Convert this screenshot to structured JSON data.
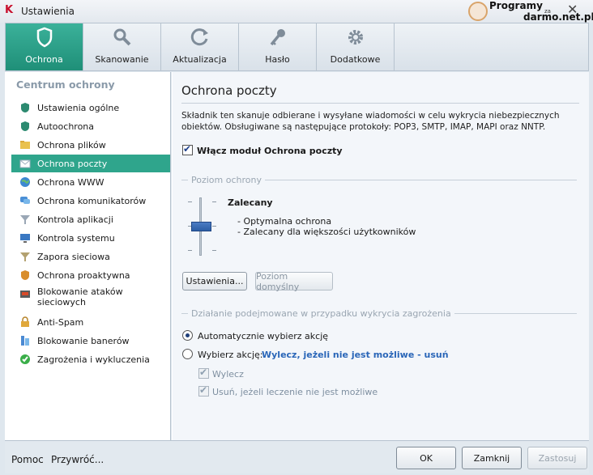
{
  "window": {
    "title": "Ustawienia"
  },
  "watermark": {
    "line1": "Programy",
    "line2": "za",
    "line3": "darmo.net.pl"
  },
  "tabs": [
    {
      "label": "Ochrona",
      "icon": "shield-icon",
      "active": true
    },
    {
      "label": "Skanowanie",
      "icon": "magnifier-icon"
    },
    {
      "label": "Aktualizacja",
      "icon": "refresh-icon"
    },
    {
      "label": "Hasło",
      "icon": "key-icon"
    },
    {
      "label": "Dodatkowe",
      "icon": "gear-icon"
    }
  ],
  "sidebar": {
    "heading": "Centrum ochrony",
    "items": [
      {
        "label": "Ustawienia ogólne",
        "icon": "shield-green-icon"
      },
      {
        "label": "Autoochrona",
        "icon": "shield-green-icon"
      },
      {
        "label": "Ochrona plików",
        "icon": "folder-icon"
      },
      {
        "label": "Ochrona poczty",
        "icon": "envelope-icon",
        "active": true
      },
      {
        "label": "Ochrona WWW",
        "icon": "globe-icon"
      },
      {
        "label": "Ochrona komunikatorów",
        "icon": "chat-icon"
      },
      {
        "label": "Kontrola aplikacji",
        "icon": "funnel-icon"
      },
      {
        "label": "Kontrola systemu",
        "icon": "monitor-icon"
      },
      {
        "label": "Zapora sieciowa",
        "icon": "funnel-icon"
      },
      {
        "label": "Ochrona proaktywna",
        "icon": "shield-orange-icon"
      },
      {
        "label": "Blokowanie ataków sieciowych",
        "icon": "network-icon"
      },
      {
        "label": "Anti-Spam",
        "icon": "lock-icon"
      },
      {
        "label": "Blokowanie banerów",
        "icon": "banner-icon"
      },
      {
        "label": "Zagrożenia i wykluczenia",
        "icon": "check-circle-icon"
      }
    ]
  },
  "main": {
    "title": "Ochrona poczty",
    "description": "Składnik ten skanuje odbierane i wysyłane wiadomości w celu wykrycia niebezpiecznych obiektów. Obsługiwane są następujące protokoły: POP3, SMTP, IMAP, MAPI oraz NNTP.",
    "enable_label": "Włącz moduł Ochrona poczty",
    "enable_checked": true,
    "level_section": "Poziom ochrony",
    "level_name": "Zalecany",
    "level_points": [
      "- Optymalna ochrona",
      "- Zalecany dla większości użytkowników"
    ],
    "settings_button": "Ustawienia...",
    "default_button": "Poziom domyślny",
    "action_section": "Działanie podejmowane w przypadku wykrycia zagrożenia",
    "radio_auto": "Automatycznie wybierz akcję",
    "radio_choose": "Wybierz akcję:",
    "chosen_action": "Wylecz, jeżeli nie jest możliwe - usuń",
    "sub_disinfect": "Wylecz",
    "sub_delete": "Usuń, jeżeli leczenie nie jest możliwe"
  },
  "footer": {
    "help": "Pomoc",
    "restore": "Przywróć...",
    "ok": "OK",
    "close": "Zamknij",
    "apply": "Zastosuj"
  }
}
